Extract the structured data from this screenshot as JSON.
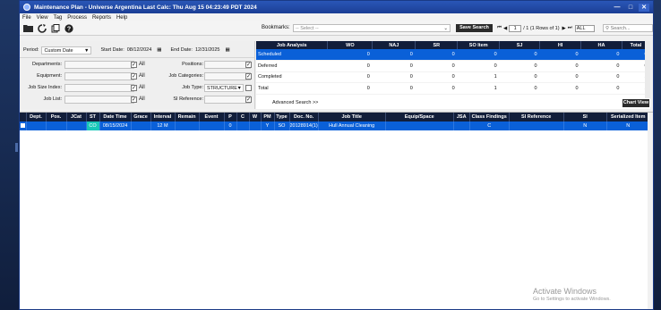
{
  "window": {
    "title": "Maintenance Plan - Universe Argentina  Last Calc: Thu Aug 15 04:23:49 PDT 2024"
  },
  "menu": [
    "File",
    "View",
    "Tag",
    "Process",
    "Reports",
    "Help"
  ],
  "toolbar": {
    "bookmarks_label": "Bookmarks:",
    "bookmarks_placeholder": "-- Select --",
    "save_search": "Save Search",
    "page_value": "1",
    "page_info": "/ 1 (1 Rows of 1)",
    "page_size": "ALL",
    "quick_search_placeholder": "Search..."
  },
  "filters": {
    "period_label": "Period:",
    "period_value": "Custom Date",
    "start_label": "Start Date:",
    "start_value": "08/12/2024",
    "end_label": "End Date:",
    "end_value": "12/31/2025",
    "departments": "Departments:",
    "positions": "Positions:",
    "equipment": "Equipment:",
    "job_categories": "Job Categories:",
    "job_size_index": "Job Size Index:",
    "job_type": "Job Type:",
    "job_type_value": "STRUCTURE",
    "job_list": "Job List:",
    "si_reference": "SI Reference:",
    "all": "All"
  },
  "analysis": {
    "headers": [
      "Job Analysis",
      "WO",
      "NAJ",
      "SR",
      "SO Item",
      "SJ",
      "HI",
      "HA",
      "Total"
    ],
    "rows": [
      [
        "Scheduled",
        "0",
        "0",
        "0",
        "0",
        "0",
        "0",
        "0",
        "0"
      ],
      [
        "Deferred",
        "0",
        "0",
        "0",
        "0",
        "0",
        "0",
        "0",
        "0"
      ],
      [
        "Completed",
        "0",
        "0",
        "0",
        "1",
        "0",
        "0",
        "0",
        "1"
      ],
      [
        "Total",
        "0",
        "0",
        "0",
        "1",
        "0",
        "0",
        "0",
        "1"
      ]
    ],
    "advanced_search": "Advanced Search >>",
    "chart_view": "Chart View"
  },
  "grid": {
    "headers": [
      "",
      "Dept.",
      "Pos.",
      "JCat",
      "ST",
      "Date Time",
      "Grace",
      "Interval",
      "Remain",
      "Event",
      "P",
      "C",
      "W",
      "PM",
      "Type",
      "Doc. No.",
      "Job Title",
      "Equip/Space",
      "JSA",
      "Class Findings",
      "SI Reference",
      "SI",
      "Serialized Item"
    ],
    "rows": [
      [
        "",
        "",
        "",
        "",
        "CO",
        "08/15/2024",
        "",
        "12 M",
        "",
        "",
        "0",
        "",
        "",
        "Y",
        "SO",
        "20128914(1)",
        "Hull Annual Cleaning",
        "",
        "",
        "C",
        "",
        "N",
        "N"
      ]
    ]
  },
  "watermark": {
    "line1": "Activate Windows",
    "line2": "Go to Settings to activate Windows."
  },
  "colors": {
    "title_bar": "#2a57b7",
    "header_dark": "#121e3a",
    "selection": "#0a60d8",
    "status_teal": "#19c7b8"
  }
}
